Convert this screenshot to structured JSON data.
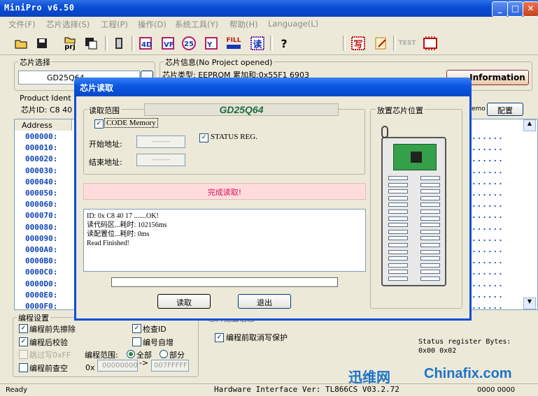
{
  "window": {
    "title": "MiniPro v6.50"
  },
  "menu": [
    "文件(F)",
    "芯片选择(S)",
    "工程(P)",
    "操作(D)",
    "系统工具(Y)",
    "帮助(H)",
    "Language(L)"
  ],
  "toolbar": {
    "icons": [
      "open-folder",
      "save-disk",
      "open-project",
      "save-project",
      "chip",
      "read-chip",
      "verify-chip",
      "blank-check",
      "program-chip",
      "fill",
      "read-config",
      "help",
      "write",
      "edit",
      "test",
      "ic"
    ],
    "labels": {
      "prj": "prj",
      "fill": "FILL",
      "read": "读",
      "write": "写",
      "test": "TEST",
      "help": "?"
    }
  },
  "chip_select": {
    "label": "芯片选择",
    "value": "GD25Q64"
  },
  "chip_info": {
    "label": "芯片信息(No Project opened)",
    "line": "芯片类型: EEPROM  累加和:0x55F1 6903",
    "info_button": "Information"
  },
  "product_ident": {
    "label": "Product Ident",
    "value": "芯片ID: C8 40"
  },
  "memo": {
    "label": "emo",
    "config_button": "配置"
  },
  "hex": {
    "header": "Address",
    "addresses": [
      "000000:",
      "000010:",
      "000020:",
      "000030:",
      "000040:",
      "000050:",
      "000060:",
      "000070:",
      "000080:",
      "000090:",
      "0000A0:",
      "0000B0:",
      "0000C0:",
      "0000D0:",
      "0000E0:",
      "0000F0:"
    ],
    "dots": "......"
  },
  "dialog": {
    "title": "芯片读取",
    "read_range_label": "读取范围",
    "chip_name": "GD25Q64",
    "code_memory": "CODE Memory",
    "status_reg": "STATUS REG.",
    "start_addr_label": "开始地址:",
    "end_addr_label": "结束地址:",
    "start_addr": "--------",
    "end_addr": "--------",
    "status": "完成读取!",
    "log": [
      "ID: 0x C8 40 17 .......OK!",
      "读代码区...耗时: 102156ms",
      "读配置位...耗时: 0ms",
      "Read Finished!"
    ],
    "progress": 0,
    "read_button": "读取",
    "exit_button": "退出",
    "placement_label": "放置芯片位置"
  },
  "prog_settings": {
    "label": "编程设置",
    "erase": "编程前先擦除",
    "verify": "编程后校验",
    "skip": "跳过写0xFF",
    "blank": "编程前查空",
    "check_id": "检查ID",
    "auto_num": "编号自增",
    "range_label": "编程范围:",
    "all": "全部",
    "part": "部分",
    "prefix": "0x",
    "range_start": "00000000",
    "range_end": "007FFFFF",
    "checks": {
      "erase": true,
      "verify": true,
      "skip": false,
      "blank": false,
      "check_id": true,
      "auto_num": false
    }
  },
  "misc": {
    "protect": "编程前取消写保护",
    "status_bytes_label": "Status register Bytes:",
    "status_bytes": "0x00 0x02",
    "partial_label": "芯片配置信息"
  },
  "statusbar": {
    "ready": "Ready",
    "hw": "Hardware Interface Ver: TL866CS V03.2.72",
    "right": "0000 0000"
  },
  "watermark": {
    "site": "Chinafix.com",
    "brand": "迅维网"
  }
}
